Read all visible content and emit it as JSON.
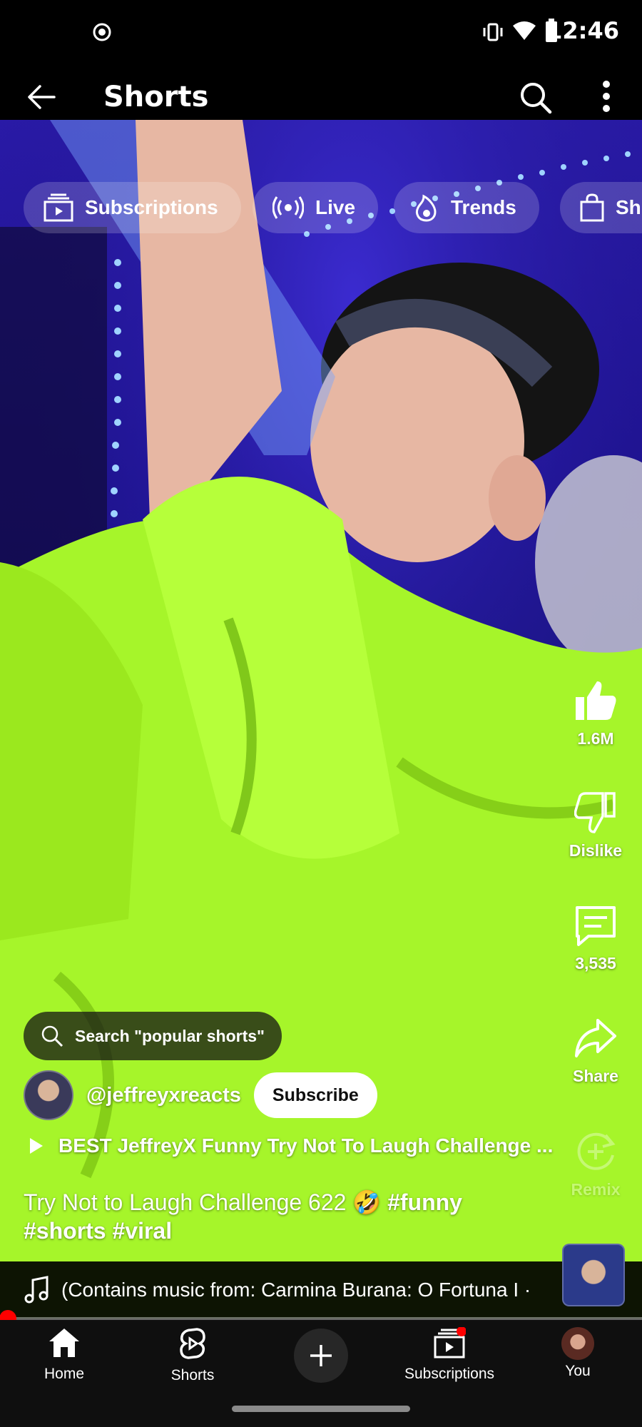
{
  "status_bar": {
    "time": "12:46"
  },
  "app_bar": {
    "title": "Shorts"
  },
  "chips": [
    {
      "label": "Subscriptions",
      "icon": "subscriptions-icon"
    },
    {
      "label": "Live",
      "icon": "live-icon"
    },
    {
      "label": "Trends",
      "icon": "trending-icon"
    },
    {
      "label": "Sh",
      "icon": "shopping-bag-icon"
    }
  ],
  "actions": {
    "like_count": "1.6M",
    "dislike_label": "Dislike",
    "comments_count": "3,535",
    "share_label": "Share",
    "remix_label": "Remix"
  },
  "search_suggestion": "Search \"popular shorts\"",
  "channel": {
    "handle": "@jeffreyxreacts",
    "subscribe_label": "Subscribe"
  },
  "playlist_title": "BEST JeffreyX Funny Try Not To Laugh Challenge ...",
  "caption": {
    "text": "Try Not to Laugh Challenge 622 🤣",
    "hashtag1": "#funny",
    "hashtag2": "#shorts",
    "hashtag3": "#viral"
  },
  "music": {
    "text": "(Contains music from: Carmina Burana: O Fortuna I ·"
  },
  "progress": {
    "fraction": 0.012
  },
  "bottom_nav": {
    "home": "Home",
    "shorts": "Shorts",
    "subscriptions": "Subscriptions",
    "you": "You"
  },
  "colors": {
    "accent": "#ff0000",
    "shirt": "#a6f52a",
    "background": "#1e1290"
  }
}
